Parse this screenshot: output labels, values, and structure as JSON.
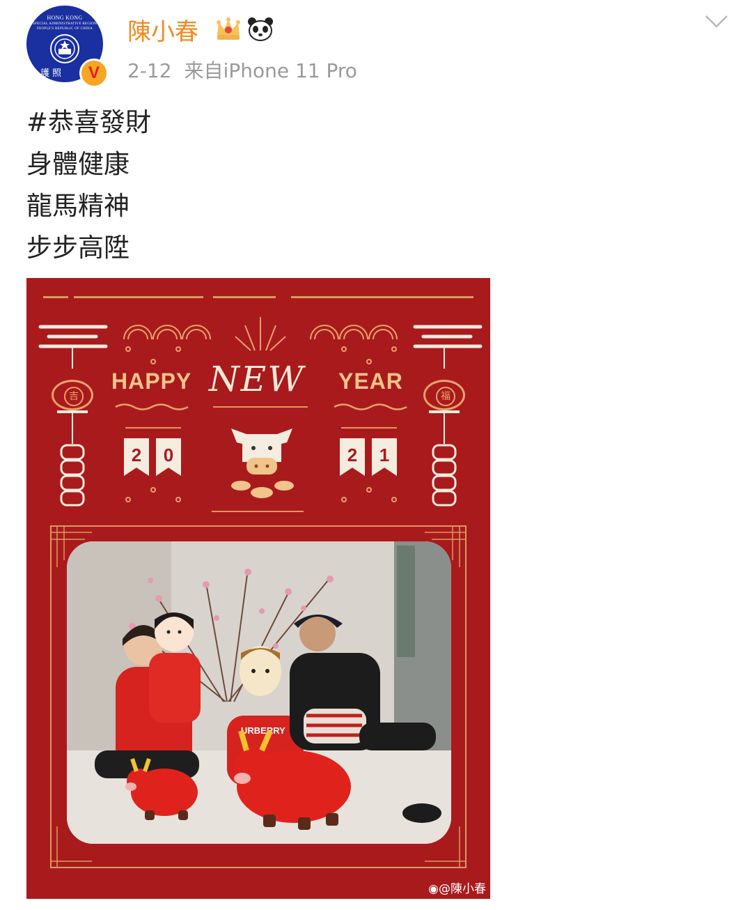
{
  "header": {
    "username": "陳小春",
    "date": "2-12",
    "source": "来自iPhone 11 Pro",
    "badge": "V",
    "avatar_text": {
      "line1": "HONG KONG",
      "line2": "SPECIAL ADMINISTRATIVE REGION",
      "line3": "PEOPLE'S REPUBLIC OF CHINA",
      "line4": "護 照"
    },
    "icons": [
      "crown-icon",
      "panda-icon",
      "chevron-down-icon"
    ]
  },
  "post": {
    "lines": [
      "#恭喜發財",
      "身體健康",
      "龍馬精神",
      "步步高陞"
    ]
  },
  "card": {
    "happy": "HAPPY",
    "new": "NEW",
    "year": "YEAR",
    "digits": [
      "2",
      "0",
      "2",
      "1"
    ],
    "lantern_left": "吉",
    "lantern_right": "福",
    "jersey_text": "URBERRY",
    "watermark": "@陳小春"
  },
  "colors": {
    "username": "#f08a1e",
    "meta": "#9a9a9a",
    "card_red": "#a91a1d",
    "gold": "#e9bf7c",
    "verified": "#f5a623"
  }
}
